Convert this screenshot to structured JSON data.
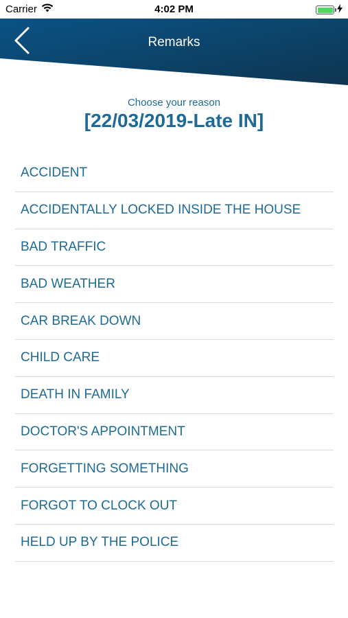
{
  "status_bar": {
    "carrier": "Carrier",
    "time": "4:02 PM",
    "icons": [
      "wifi-icon",
      "battery-icon",
      "charging-bolt-icon"
    ]
  },
  "header": {
    "title": "Remarks",
    "back_icon": "chevron-left-icon",
    "gradient_colors": [
      "#0a4d7e",
      "#0f3a5a"
    ]
  },
  "prompt_text": "Choose your reason",
  "date_title": "[22/03/2019-Late IN]",
  "reasons": [
    "ACCIDENT",
    "ACCIDENTALLY LOCKED INSIDE THE HOUSE",
    "BAD TRAFFIC",
    "BAD WEATHER",
    "CAR BREAK DOWN",
    "CHILD CARE",
    "DEATH IN FAMILY",
    "DOCTOR'S APPOINTMENT",
    "FORGETTING SOMETHING",
    "FORGOT TO CLOCK OUT",
    "HELD UP BY THE POLICE"
  ],
  "colors": {
    "accent_text": "#1d6a96",
    "divider": "#dcdcdc",
    "battery": "#4cd964"
  }
}
